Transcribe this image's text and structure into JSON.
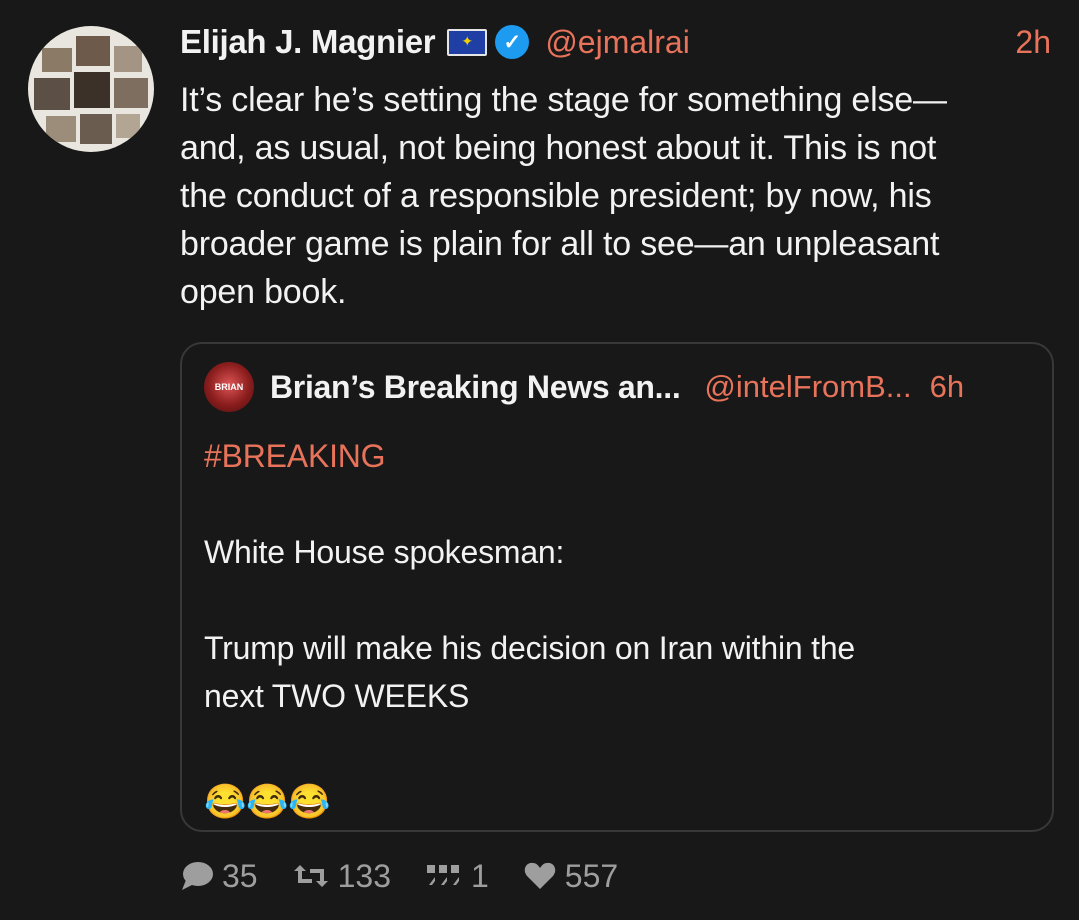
{
  "post": {
    "author_name": "Elijah J. Magnier",
    "handle": "@ejmalrai",
    "time": "2h",
    "text_lines": [
      "It’s clear he’s setting the stage for something else—",
      "and, as usual, not being honest about it. This is not",
      "the conduct of a responsible president; by now, his",
      "broader game is plain for all to see—an unpleasant",
      "open book."
    ]
  },
  "quote": {
    "author_name": "Brian’s Breaking News an...",
    "handle": "@intelFromB...",
    "time": "6h",
    "avatar_text": "BRIAN",
    "hashtag": "#BREAKING",
    "line_2": "White House spokesman:",
    "line_3": "Trump will make his decision on Iran within the",
    "line_4": "next TWO WEEKS",
    "emojis": "😂😂😂"
  },
  "actions": {
    "replies": "35",
    "reposts": "133",
    "quotes": "1",
    "likes": "557"
  },
  "colors": {
    "background": "#181818",
    "accent": "#e8735a",
    "verified": "#1d9bf0",
    "muted": "#9e9e9e"
  }
}
